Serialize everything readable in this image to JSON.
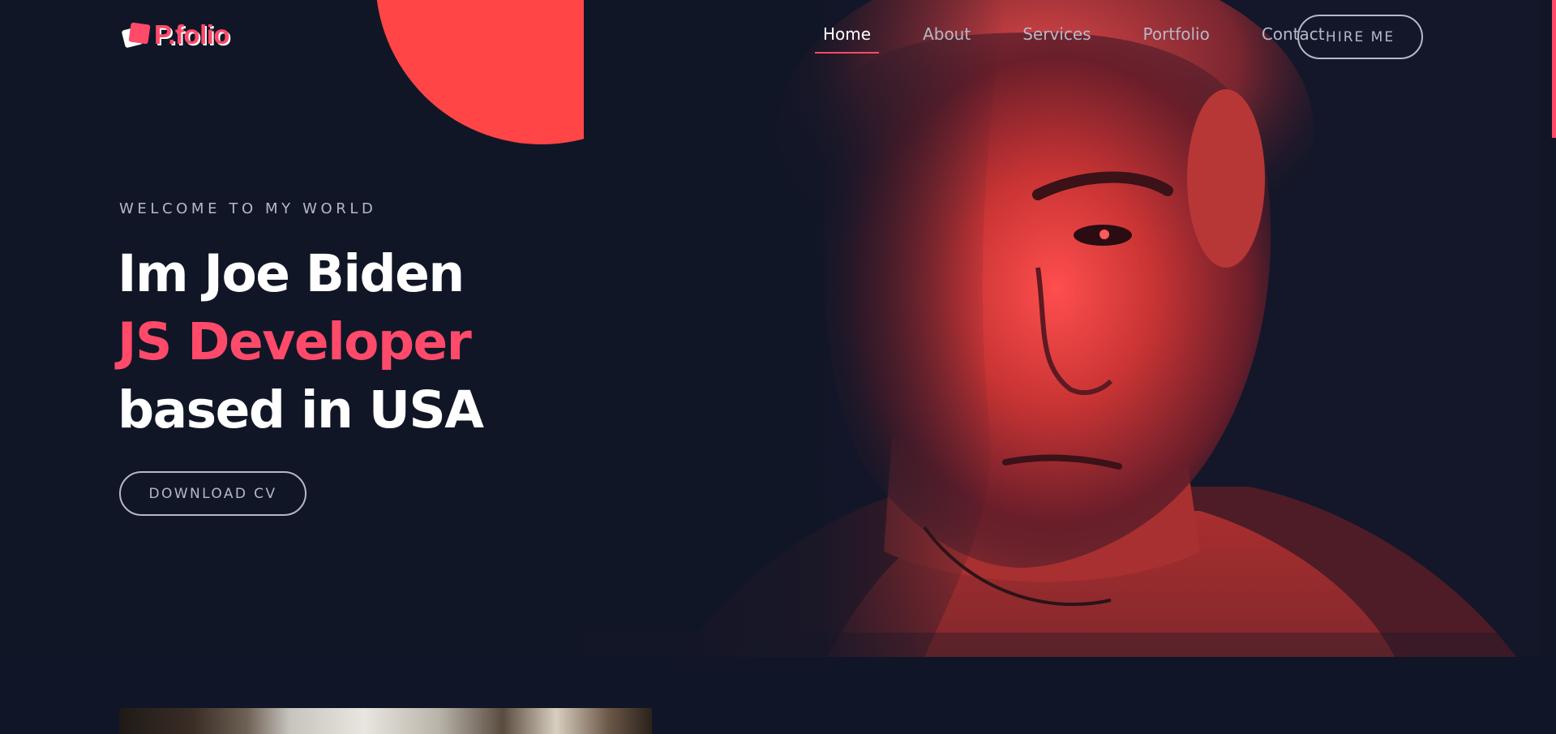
{
  "brand": {
    "name": "P.folio"
  },
  "nav": {
    "items": [
      "Home",
      "About",
      "Services",
      "Portfolio",
      "Contact"
    ],
    "active": "Home",
    "hire_label": "HIRE ME"
  },
  "hero": {
    "eyebrow": "WELCOME TO MY WORLD",
    "line1": "Im Joe Biden",
    "line2": "JS Developer",
    "line3": "based in USA",
    "cta_label": "DOWNLOAD CV"
  },
  "colors": {
    "background": "#111627",
    "accent": "#ff4a6a",
    "circle": "#ff4545",
    "muted_text": "#b5b8c7"
  },
  "icons": {
    "logo": "logo-icon"
  }
}
